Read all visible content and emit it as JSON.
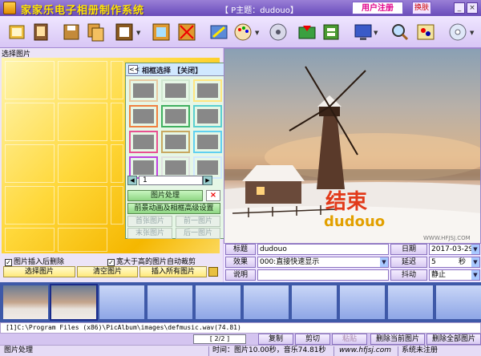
{
  "window": {
    "title": "家家乐电子相册制作系统",
    "theme_label": "【 P主题：dudouo】",
    "register_label": "用户注册",
    "skin_label": "换肤",
    "minimize": "_",
    "close": "×"
  },
  "toolbar": {
    "icons": [
      "open-folder-icon",
      "album-icon",
      "save-icon",
      "copy-icon",
      "frame-icon",
      "photo-frame-icon",
      "delete-photo-icon",
      "brush-icon",
      "palette-icon",
      "music-icon",
      "install-icon",
      "gallery-icon",
      "display-icon",
      "search-icon",
      "paint-icon",
      "disc-icon"
    ]
  },
  "left": {
    "header": "选择图片",
    "checkbox_delete_label": "图片插入后删除",
    "checkbox_crop_label": "宽大于高的图片自动裁剪",
    "select_btn": "选择图片",
    "clear_btn": "清空图片",
    "insert_all_btn": "插入所有图片"
  },
  "frame_panel": {
    "back": "<<",
    "title": "相框选择 【关闭】",
    "page": "1",
    "process_btn": "图片处理",
    "delete_btn": "×",
    "advanced_btn": "前景动画及相框高级设置",
    "first_btn": "首张图片",
    "prev_btn": "前一图片",
    "last_btn": "末张图片",
    "next_btn": "后一图片"
  },
  "preview": {
    "overlay_big": "结束",
    "overlay_small": "dudouo",
    "watermark": "WWW.HFJSJ.COM"
  },
  "info": {
    "title_label": "标题",
    "title_value": "dudouo",
    "date_label": "日期",
    "date_value": "2017-03-29",
    "effect_label": "效果",
    "effect_value": "000:直接快速显示",
    "delay_label": "延迟",
    "delay_value": "5",
    "delay_unit": "秒",
    "note_label": "说明",
    "shake_label": "抖动",
    "shake_value": "静止"
  },
  "music": {
    "path": "[1]C:\\Program Files (x86)\\PicAlbum\\images\\defmusic.wav(74.81)"
  },
  "controls": {
    "page": "[ 2/2 ]",
    "copy": "复制",
    "cut": "剪切",
    "paste": "粘贴",
    "delete_current": "删除当前图片",
    "delete_all": "删除全部图片"
  },
  "status": {
    "left": "图片处理",
    "time": "时间：图片10.00秒，音乐74.81秒",
    "url": "www.hfjsj.com",
    "reg": "系统未注册"
  },
  "colors": {
    "title_bar": "#7b5fc6",
    "title_text": "#ffe600",
    "film_strip": "#3e59a8",
    "preview_text_red": "#e23a1a",
    "preview_text_gold": "#e2a000"
  }
}
